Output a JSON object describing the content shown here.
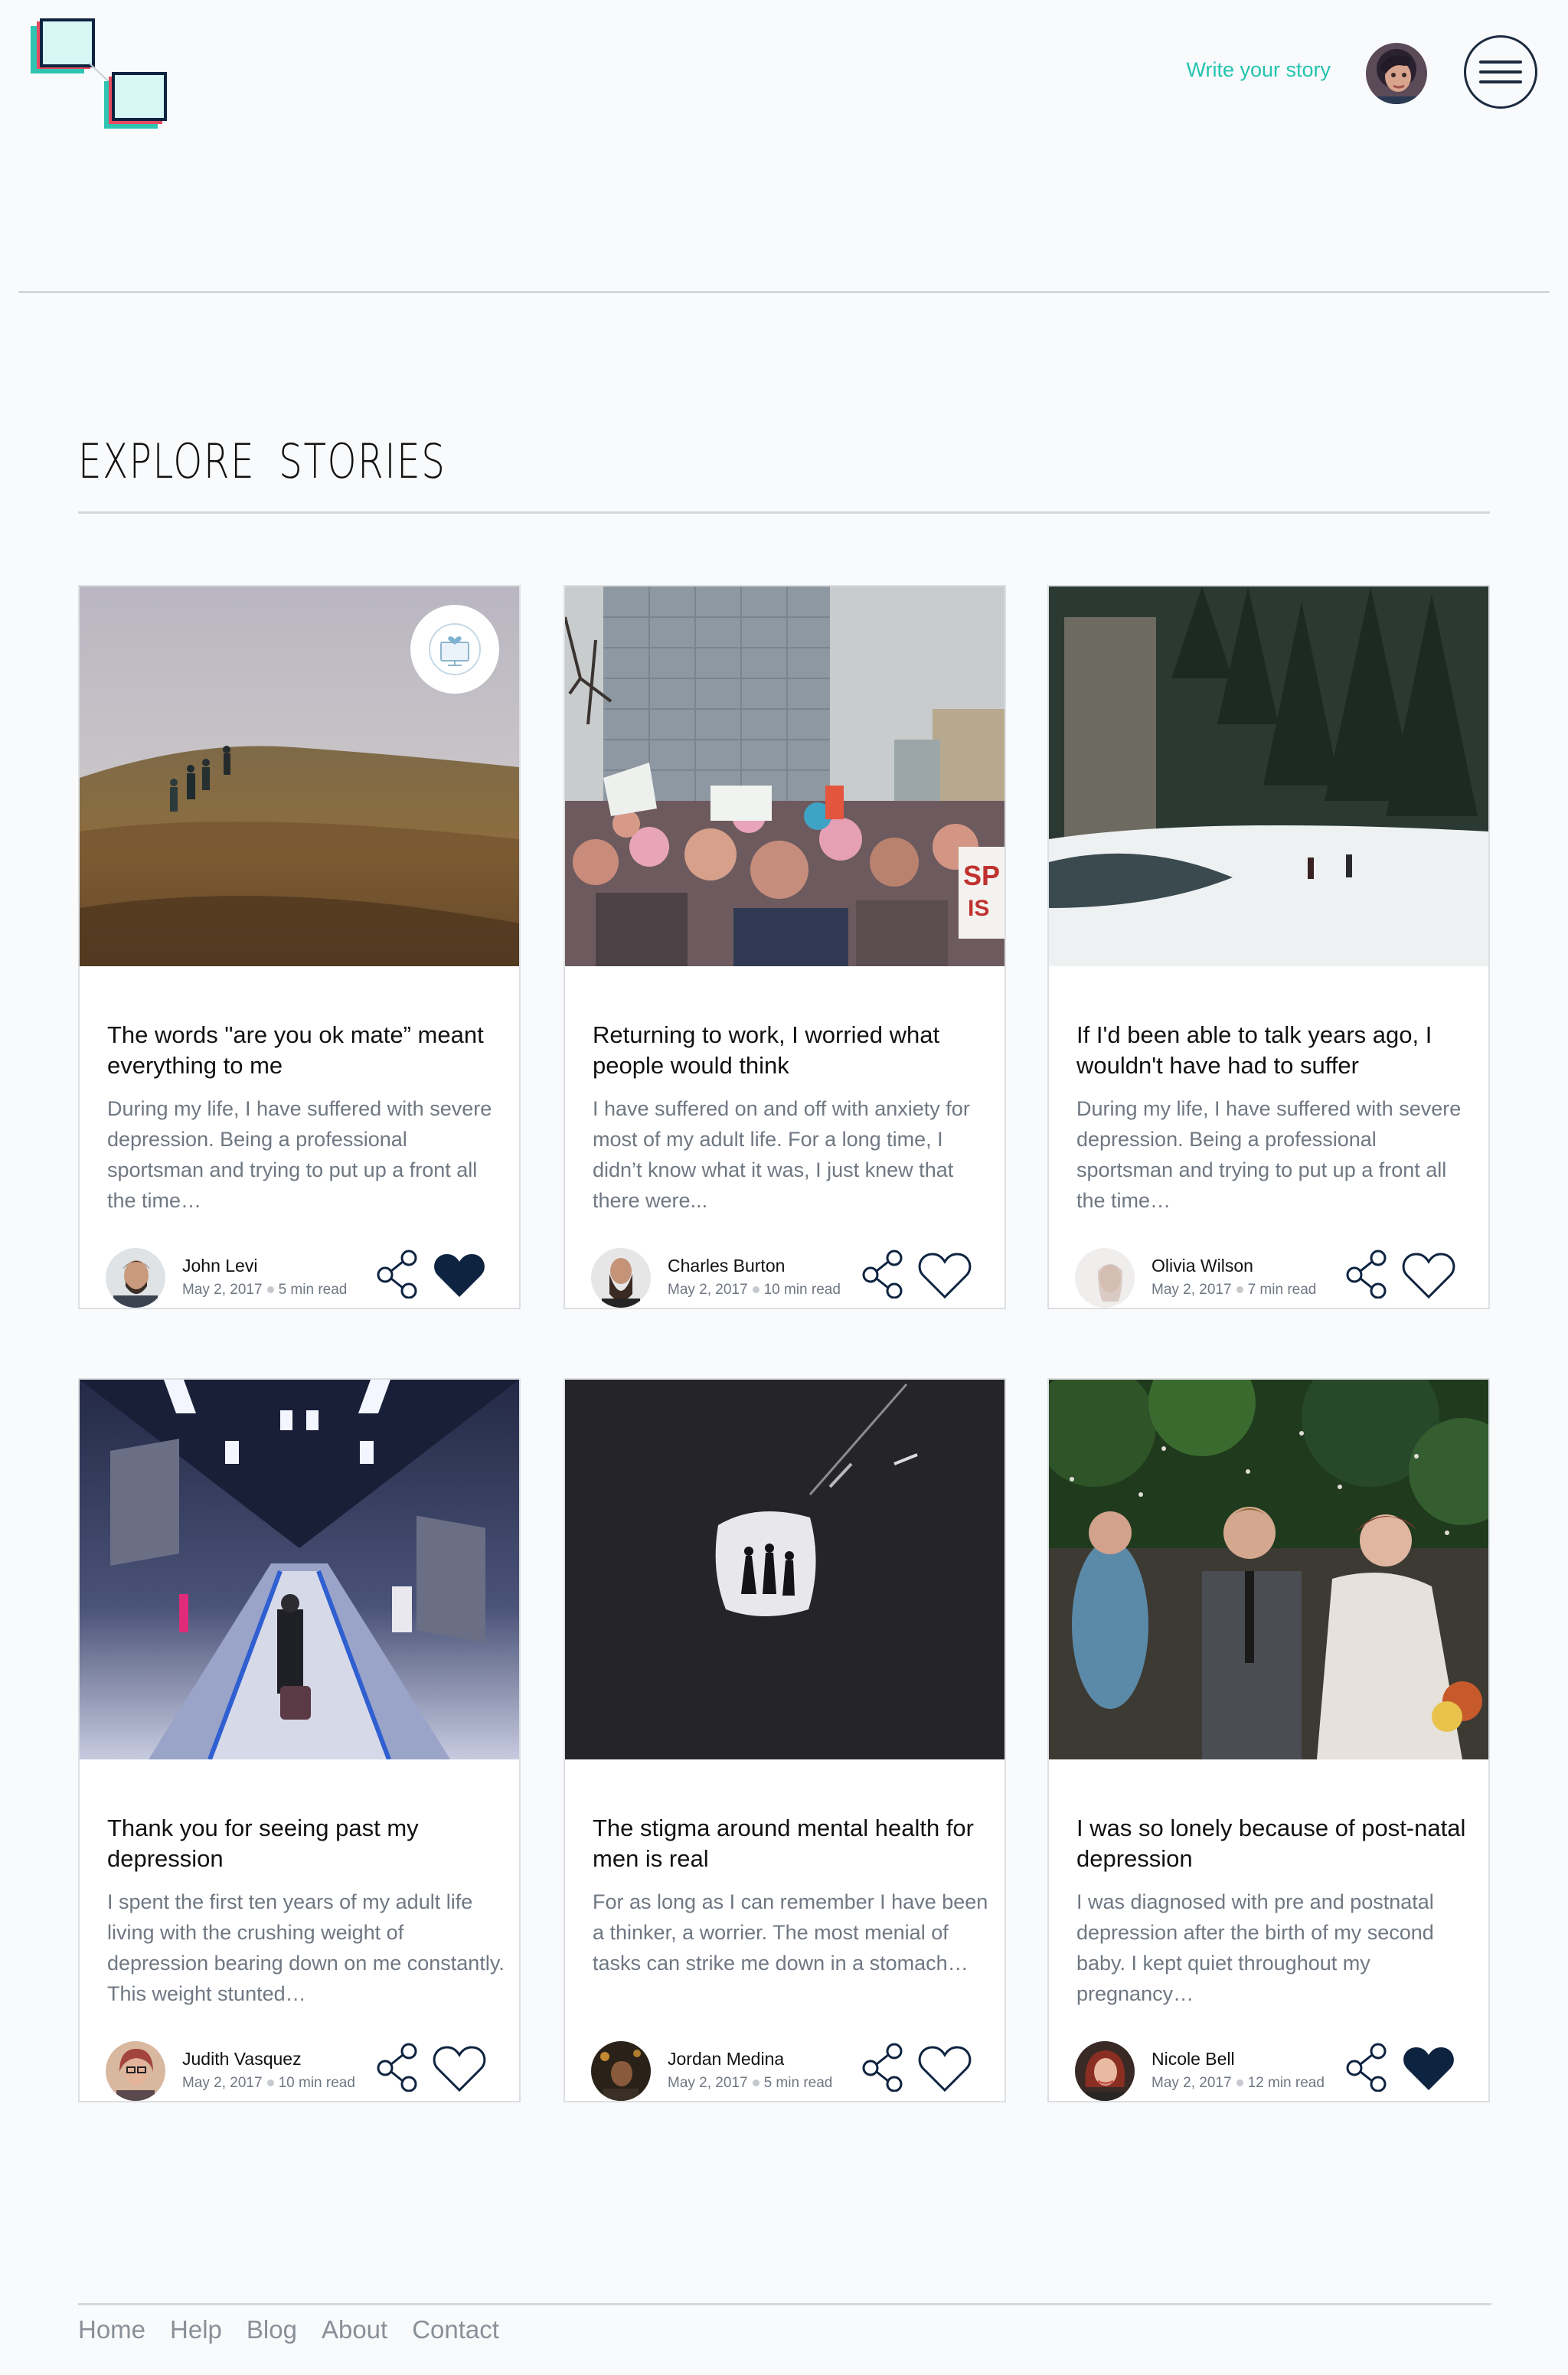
{
  "header": {
    "logo_icon": "layered-squares-logo",
    "write_story_label": "Write your story",
    "avatar_icon": "user-avatar",
    "menu_icon": "hamburger-menu-icon"
  },
  "section": {
    "title": "EXPLORE STORIES"
  },
  "colors": {
    "accent": "#23c4ae",
    "navy": "#0e2340",
    "rule": "#d4d7db",
    "logo_red": "#e84a5f",
    "logo_teal": "#2fc4b2",
    "logo_mint": "#d6f7f4"
  },
  "cards": [
    {
      "title": "The words \"are you ok mate” meant everything to me",
      "excerpt": "During my life, I have suffered with severe depression. Being a professional sportsman and trying to put up a front all the time…",
      "author": "John Levi",
      "date": "May 2, 2017",
      "read_time": "5 min read",
      "liked": true,
      "image": "hikers-on-grassy-hill",
      "badge": "computer-heart-badge"
    },
    {
      "title": "Returning to work, I worried what people would think",
      "excerpt": "I have suffered on and off with anxiety for most of my adult life. For a long time, I didn’t know what it was, I just knew that there were...",
      "author": "Charles Burton",
      "date": "May 2, 2017",
      "read_time": "10 min read",
      "liked": false,
      "image": "city-march-crowd"
    },
    {
      "title": "If I'd been able to talk years ago, I wouldn't have had to suffer",
      "excerpt": "During my life, I have suffered with severe depression. Being a professional sportsman and trying to put up a front all the time…",
      "author": "Olivia Wilson",
      "date": "May 2, 2017",
      "read_time": "7 min read",
      "liked": false,
      "image": "snowy-forest-river"
    },
    {
      "title": "Thank you for seeing past my depression",
      "excerpt": "I spent the first ten years of my adult life living with the crushing weight of depression bearing down on me constantly. This weight stunted…",
      "author": "Judith Vasquez",
      "date": "May 2, 2017",
      "read_time": "10 min read",
      "liked": false,
      "image": "underground-escalator-tunnel"
    },
    {
      "title": "The stigma around mental health for men is real",
      "excerpt": "For as long as I can remember I have been a thinker, a worrier. The most menial of tasks can strike me down in a stomach…",
      "author": "Jordan Medina",
      "date": "May 2, 2017",
      "read_time": "5 min read",
      "liked": false,
      "image": "dark-tunnel-silhouettes"
    },
    {
      "title": "I was so lonely because of post-natal depression",
      "excerpt": "I was diagnosed with pre and postnatal depression after the birth of my second baby. I kept quiet throughout my pregnancy…",
      "author": "Nicole Bell",
      "date": "May 2, 2017",
      "read_time": "12 min read",
      "liked": true,
      "image": "wedding-couple-confetti"
    }
  ],
  "icons": {
    "share": "share-icon",
    "like": "heart-icon"
  },
  "footer": {
    "links": [
      "Home",
      "Help",
      "Blog",
      "About",
      "Contact"
    ]
  }
}
